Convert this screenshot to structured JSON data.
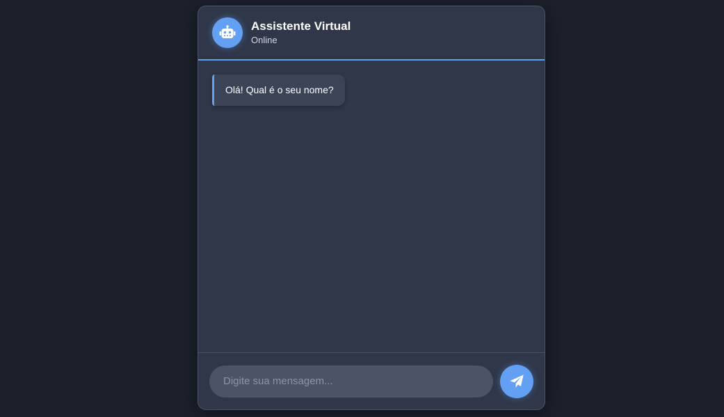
{
  "header": {
    "title": "Assistente Virtual",
    "status": "Online",
    "avatar_icon": "robot-icon"
  },
  "messages": [
    {
      "sender": "bot",
      "text": "Olá! Qual é o seu nome?"
    }
  ],
  "composer": {
    "placeholder": "Digite sua mensagem...",
    "value": "",
    "send_icon": "paper-plane-icon"
  },
  "colors": {
    "background": "#1b202b",
    "panel": "#2f3749",
    "accent": "#63a0f4",
    "bubble": "#3b4456",
    "input": "#4a5466"
  }
}
